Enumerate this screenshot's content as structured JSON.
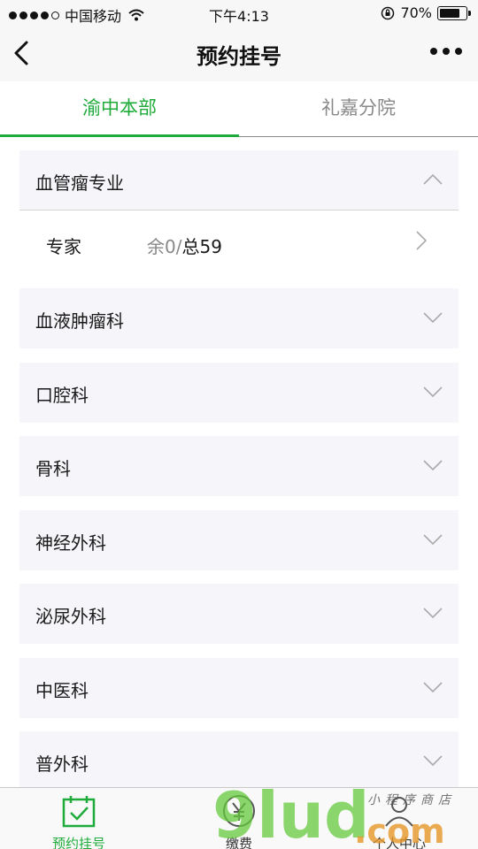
{
  "status_bar": {
    "carrier": "中国移动",
    "time": "下午4:13",
    "battery_percent": "70%",
    "battery_level": 0.7,
    "signal_bars_filled": 4,
    "signal_bars_total": 5
  },
  "nav": {
    "title": "预约挂号",
    "back_icon": "chevron-left-icon",
    "more_icon": "more-dots-icon"
  },
  "tabs": [
    {
      "label": "渝中本部",
      "active": true
    },
    {
      "label": "礼嘉分院",
      "active": false
    }
  ],
  "departments": [
    {
      "name": "血管瘤专业",
      "expanded": true,
      "rows": [
        {
          "type": "专家",
          "remain": "余0/",
          "total": "总59"
        }
      ]
    },
    {
      "name": "血液肿瘤科",
      "expanded": false
    },
    {
      "name": "口腔科",
      "expanded": false
    },
    {
      "name": "骨科",
      "expanded": false
    },
    {
      "name": "神经外科",
      "expanded": false
    },
    {
      "name": "泌尿外科",
      "expanded": false
    },
    {
      "name": "中医科",
      "expanded": false
    },
    {
      "name": "普外科",
      "expanded": false
    }
  ],
  "tabbar": [
    {
      "label": "预约挂号",
      "icon": "calendar-check-icon",
      "active": true
    },
    {
      "label": "缴费",
      "icon": "yuan-icon",
      "active": false
    },
    {
      "label": "个人中心",
      "icon": "person-icon",
      "active": false
    }
  ],
  "colors": {
    "accent": "#1fab3b",
    "card_bg": "#f6f6fa",
    "muted": "#888888"
  },
  "watermark": {
    "main": "9lud",
    "domain": ".com",
    "small": "小程序商店"
  }
}
